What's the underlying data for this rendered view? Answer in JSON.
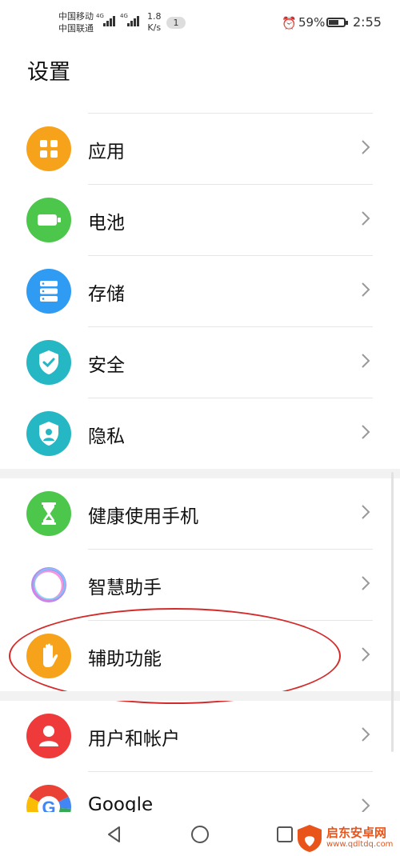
{
  "status_bar": {
    "carrier1": "中国移动",
    "carrier2": "中国联通",
    "net1": "4G",
    "net2": "4G",
    "speed_value": "1.8",
    "speed_unit": "K/s",
    "notification_count": "1",
    "battery_percent": "59%",
    "battery_level": 0.59,
    "time": "2:55"
  },
  "page_title": "设置",
  "items": [
    {
      "label": "应用",
      "icon": "apps-icon",
      "color": "#f7a21b"
    },
    {
      "label": "电池",
      "icon": "battery-icon",
      "color": "#4cc64b"
    },
    {
      "label": "存储",
      "icon": "storage-icon",
      "color": "#2f9bf2"
    },
    {
      "label": "安全",
      "icon": "shield-check-icon",
      "color": "#25b7c4"
    },
    {
      "label": "隐私",
      "icon": "privacy-icon",
      "color": "#25b7c4"
    },
    {
      "label": "健康使用手机",
      "icon": "hourglass-icon",
      "color": "#4cc64b"
    },
    {
      "label": "智慧助手",
      "icon": "assistant-ring-icon",
      "color": "#ffffff"
    },
    {
      "label": "辅助功能",
      "icon": "hand-icon",
      "color": "#f7a21b"
    },
    {
      "label": "用户和帐户",
      "icon": "user-icon",
      "color": "#ee3a3a"
    },
    {
      "label": "Google",
      "icon": "google-icon",
      "color": "#4285f4"
    }
  ],
  "watermark": {
    "title": "启东安卓网",
    "url": "www.qdltdq.com",
    "color": "#e8541a"
  },
  "annotation_color": "#d42a2a"
}
